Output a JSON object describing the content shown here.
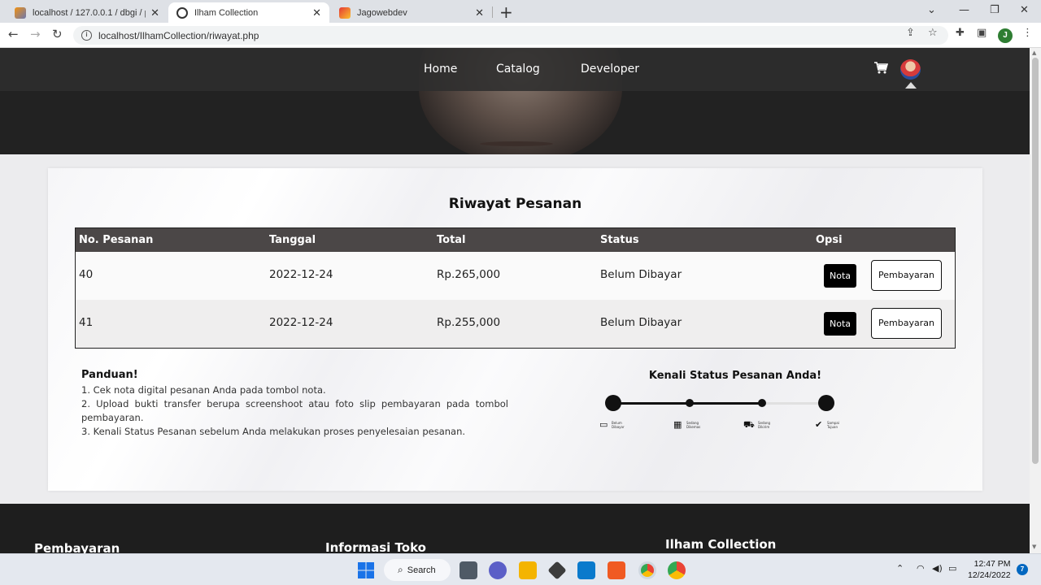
{
  "browser": {
    "tabs": [
      {
        "title": "localhost / 127.0.0.1 / dbgi / pem",
        "active": false
      },
      {
        "title": "Ilham Collection",
        "active": true
      },
      {
        "title": "Jagowebdev",
        "active": false
      }
    ],
    "url": "localhost/IlhamCollection/riwayat.php",
    "profile_initial": "J"
  },
  "nav": {
    "links": [
      "Home",
      "Catalog",
      "Developer"
    ]
  },
  "page": {
    "title": "Riwayat Pesanan",
    "table": {
      "headers": [
        "No. Pesanan",
        "Tanggal",
        "Total",
        "Status",
        "Opsi"
      ],
      "rows": [
        {
          "no": "40",
          "tanggal": "2022-12-24",
          "total": "Rp.265,000",
          "status": "Belum Dibayar",
          "nota": "Nota",
          "bayar": "Pembayaran"
        },
        {
          "no": "41",
          "tanggal": "2022-12-24",
          "total": "Rp.255,000",
          "status": "Belum Dibayar",
          "nota": "Nota",
          "bayar": "Pembayaran"
        }
      ]
    },
    "guide": {
      "title": "Panduan!",
      "lines": [
        "1. Cek nota digital pesanan Anda pada tombol nota.",
        "2. Upload bukti transfer berupa screenshoot atau foto slip pembayaran pada tombol pembayaran.",
        "3. Kenali Status Pesanan sebelum Anda melakukan proses penyelesaian pesanan."
      ]
    },
    "status_legend": {
      "title": "Kenali Status Pesanan Anda!",
      "steps": [
        "Belum Dibayar",
        "Sedang Dikemas",
        "Sedang Dikirim",
        "Sampai Tujuan"
      ]
    }
  },
  "footer": {
    "columns": [
      "Pembayaran",
      "Informasi Toko",
      "Ilham Collection"
    ]
  },
  "taskbar": {
    "search": "Search",
    "time": "12:47 PM",
    "date": "12/24/2022",
    "notifications": "7"
  }
}
